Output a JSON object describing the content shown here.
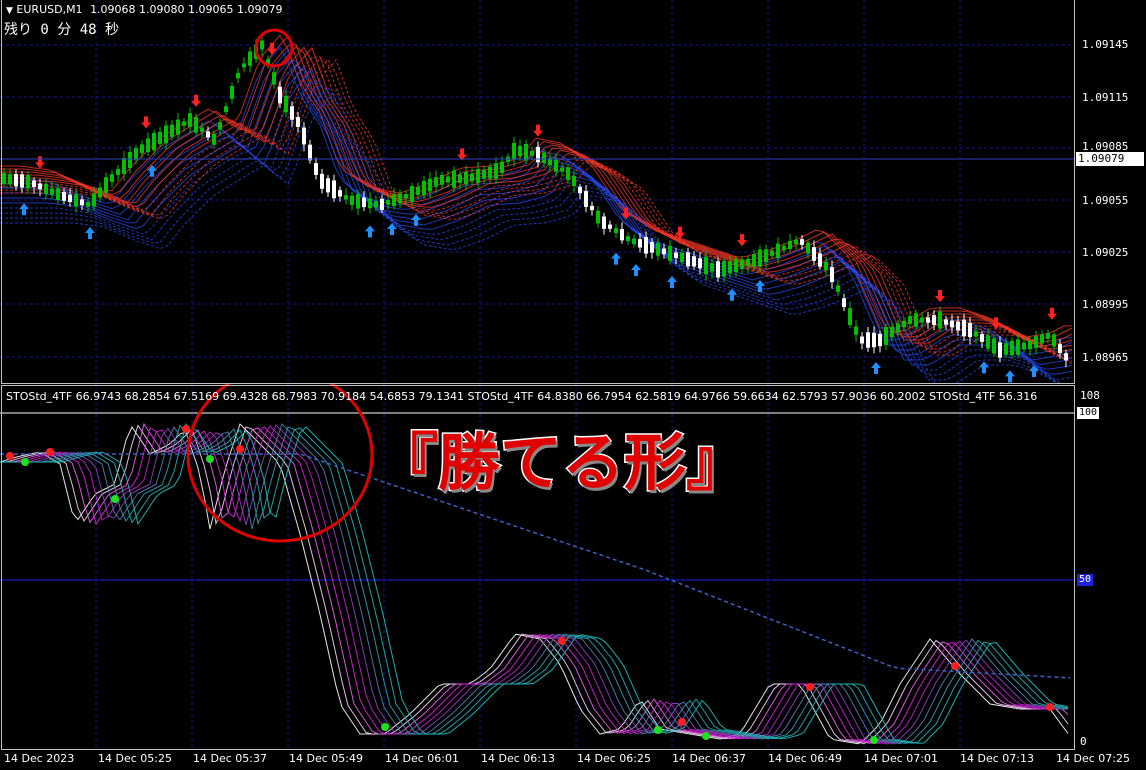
{
  "symbol_header": {
    "arrow": "▼",
    "symbol": "EURUSD,M1",
    "prices": "1.09068 1.09080 1.09065 1.09079",
    "countdown": "残り 0 分 48 秒"
  },
  "price_axis": {
    "labels": [
      "1.09145",
      "1.09115",
      "1.09085",
      "1.09055",
      "1.09025",
      "1.08995",
      "1.08965"
    ],
    "current_price": "1.09079"
  },
  "indicator": {
    "header": "STOStd_4TF 66.9743 68.2854 67.5169 69.4328 68.7983 70.9184 54.6853 79.1341    STOStd_4TF 64.8380 66.7954 62.5819 64.9766 59.6634 62.5793 57.9036 60.2002    STOStd_4TF 56.316",
    "scale_labels": [
      "108",
      "100",
      "50",
      "0"
    ]
  },
  "time_axis": {
    "labels": [
      "14 Dec 2023",
      "14 Dec 05:25",
      "14 Dec 05:37",
      "14 Dec 05:49",
      "14 Dec 06:01",
      "14 Dec 06:13",
      "14 Dec 06:25",
      "14 Dec 06:37",
      "14 Dec 06:49",
      "14 Dec 07:01",
      "14 Dec 07:13",
      "14 Dec 07:25"
    ]
  },
  "annotation": {
    "caption": "『勝てる形』"
  },
  "colors": {
    "background": "#000000",
    "grid": "#1a1a80",
    "bull_candle": "#00c000",
    "bear_candle": "#ffffff",
    "ribbon_red": "#ff3a2a",
    "ribbon_blue": "#2a50ff",
    "arrow_up": "#1e90ff",
    "arrow_down": "#ff2020",
    "stoch_magenta": "#e020e0",
    "stoch_cyan": "#20b0b0",
    "annotation_red": "#e00000"
  }
}
